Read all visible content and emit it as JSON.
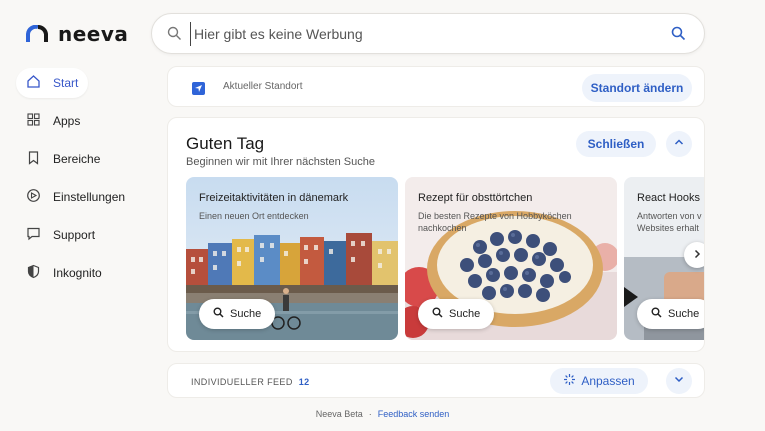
{
  "brand": {
    "name": "neeva"
  },
  "search": {
    "placeholder": "Hier gibt es keine Werbung"
  },
  "nav": {
    "items": [
      {
        "label": "Start",
        "icon": "home-icon",
        "active": true
      },
      {
        "label": "Apps",
        "icon": "grid-icon"
      },
      {
        "label": "Bereiche",
        "icon": "bookmark-icon"
      },
      {
        "label": "Einstellungen",
        "icon": "settings-icon"
      },
      {
        "label": "Support",
        "icon": "chat-icon"
      },
      {
        "label": "Inkognito",
        "icon": "shield-icon"
      }
    ]
  },
  "location": {
    "text": "Aktueller Standort",
    "button": "Standort ändern"
  },
  "greeting": {
    "title": "Guten Tag",
    "subtitle": "Beginnen wir mit Ihrer nächsten Suche",
    "close_label": "Schließen",
    "tiles": [
      {
        "title": "Freizeitaktivitäten in dänemark",
        "subtitle": "Einen neuen Ort entdecken",
        "button": "Suche"
      },
      {
        "title": "Rezept für obsttörtchen",
        "subtitle": "Die besten Rezepte von Hobbyköchen nachkochen",
        "button": "Suche"
      },
      {
        "title": "React Hooks",
        "subtitle": "Antworten von v Websites erhalt",
        "button": "Suche"
      }
    ]
  },
  "feed": {
    "label": "INDIVIDUELLER FEED",
    "count": "12",
    "adjust": "Anpassen"
  },
  "footer": {
    "beta": "Neeva Beta",
    "separator": "·",
    "feedback": "Feedback senden"
  },
  "colors": {
    "accent": "#2f5fc5",
    "background": "#f9f8f6",
    "logo_blue": "#2f64d8"
  }
}
